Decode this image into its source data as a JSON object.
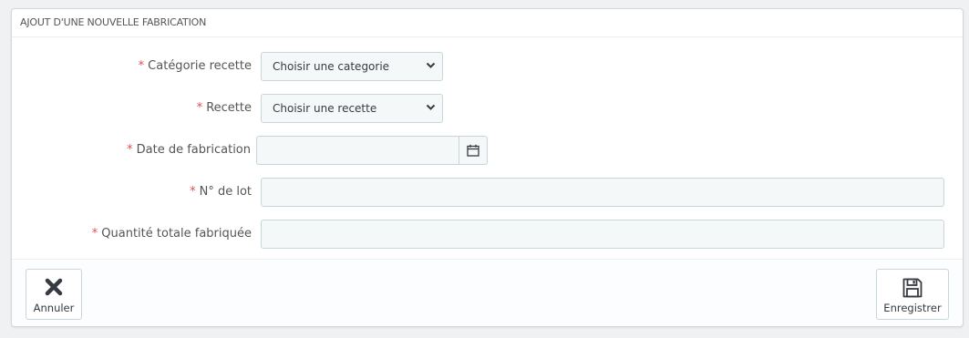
{
  "panel": {
    "title": "AJOUT D'UNE NOUVELLE FABRICATION"
  },
  "form": {
    "required_mark": "*",
    "category": {
      "label": "Catégorie recette",
      "selected": "Choisir une categorie"
    },
    "recipe": {
      "label": "Recette",
      "selected": "Choisir une recette"
    },
    "date": {
      "label": "Date de fabrication",
      "value": ""
    },
    "lot": {
      "label": "N° de lot",
      "value": ""
    },
    "quantity": {
      "label": "Quantité totale fabriquée",
      "value": ""
    }
  },
  "footer": {
    "cancel_label": "Annuler",
    "save_label": "Enregistrer"
  },
  "icons": {
    "close": "close-icon",
    "save": "save-icon",
    "calendar": "calendar-icon",
    "chevron": "chevron-down-icon"
  },
  "colors": {
    "required": "#e34f4f",
    "input_bg": "#f5f8f9",
    "input_border": "#c7d6db",
    "page_bg": "#eff1f2"
  }
}
